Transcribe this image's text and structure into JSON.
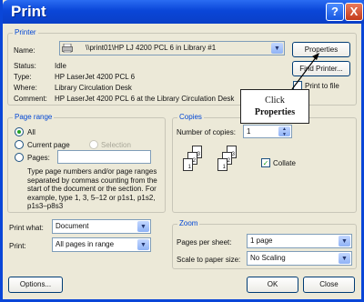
{
  "window": {
    "title": "Print",
    "help_glyph": "?",
    "close_glyph": "X"
  },
  "printer": {
    "legend": "Printer",
    "name_label": "Name:",
    "name_value": "\\\\print01\\HP LJ 4200 PCL 6 in Library #1",
    "status_label": "Status:",
    "status_value": "Idle",
    "type_label": "Type:",
    "type_value": "HP LaserJet 4200 PCL 6",
    "where_label": "Where:",
    "where_value": "Library Circulation Desk",
    "comment_label": "Comment:",
    "comment_value": "HP LaserJet 4200 PCL 6 at the Library Circulation Desk",
    "properties_label": "Properties",
    "find_printer_label": "Find Printer...",
    "print_to_file_label": "Print to file",
    "print_to_file_checked": false
  },
  "page_range": {
    "legend": "Page range",
    "all_label": "All",
    "current_page_label": "Current page",
    "selection_label": "Selection",
    "pages_label": "Pages:",
    "pages_value": "",
    "selected": "All",
    "help_text": "Type page numbers and/or page ranges separated by commas counting from the start of the document or the section. For example, type 1, 3, 5–12 or p1s1, p1s2, p1s3–p8s3"
  },
  "copies": {
    "legend": "Copies",
    "number_label": "Number of copies:",
    "number_value": "1",
    "collate_label": "Collate",
    "collate_checked": true,
    "stack_pages": [
      "3",
      "2",
      "1"
    ]
  },
  "print_what": {
    "label": "Print what:",
    "value": "Document"
  },
  "print": {
    "label": "Print:",
    "value": "All pages in range"
  },
  "zoom": {
    "legend": "Zoom",
    "pages_per_sheet_label": "Pages per sheet:",
    "pages_per_sheet_value": "1 page",
    "scale_label": "Scale to paper size:",
    "scale_value": "No Scaling"
  },
  "footer": {
    "options_label": "Options...",
    "ok_label": "OK",
    "close_label": "Close"
  },
  "callout": {
    "line1": "Click",
    "line2": "Properties"
  },
  "colors": {
    "title_bar": "#0a46d8",
    "legend_text": "#0046d5",
    "dialog_bg": "#ece9d8"
  }
}
